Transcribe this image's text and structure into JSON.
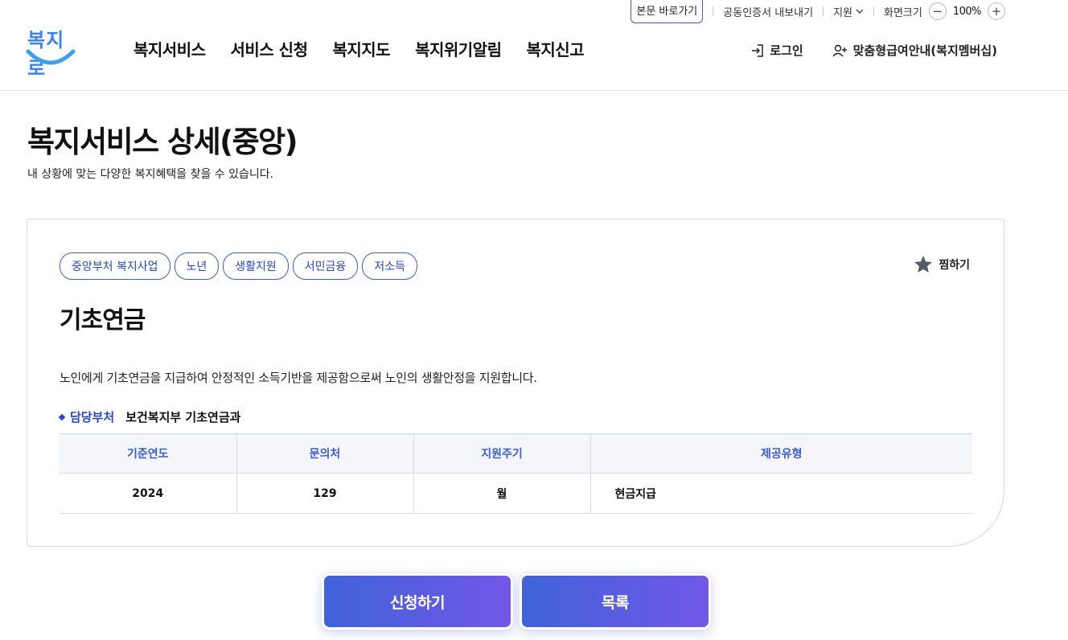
{
  "utility": {
    "skip_link": "본문 바로가기",
    "cert_export": "공동인증서 내보내기",
    "support": "지원",
    "zoom_label": "화면크기",
    "zoom_minus": "−",
    "zoom_value": "100%",
    "zoom_plus": "+"
  },
  "header": {
    "logo_text": "복지로",
    "nav": [
      "복지서비스",
      "서비스 신청",
      "복지지도",
      "복지위기알림",
      "복지신고"
    ],
    "login": "로그인",
    "membership": "맞춤형급여안내(복지멤버십)"
  },
  "page": {
    "title": "복지서비스 상세(중앙)",
    "subtitle": "내 상황에 맞는 다양한 복지혜택을 찾을 수 있습니다."
  },
  "service": {
    "tags": [
      "중앙부처 복지사업",
      "노년",
      "생활지원",
      "서민금융",
      "저소득"
    ],
    "favorite_label": "찜하기",
    "title": "기초연금",
    "description": "노인에게 기초연금을 지급하여 안정적인 소득기반을 제공함으로써 노인의 생활안정을 지원합니다.",
    "dept_label": "담당부처",
    "dept_value": "보건복지부 기초연금과",
    "table": {
      "headers": [
        "기준연도",
        "문의처",
        "지원주기",
        "제공유형"
      ],
      "row": [
        "2024",
        "129",
        "월",
        "현금지급"
      ]
    }
  },
  "actions": {
    "apply": "신청하기",
    "list": "목록"
  },
  "colors": {
    "accent": "#3b5bdb",
    "button_gradient_start": "#3f63d9",
    "button_gradient_end": "#7257e8"
  }
}
